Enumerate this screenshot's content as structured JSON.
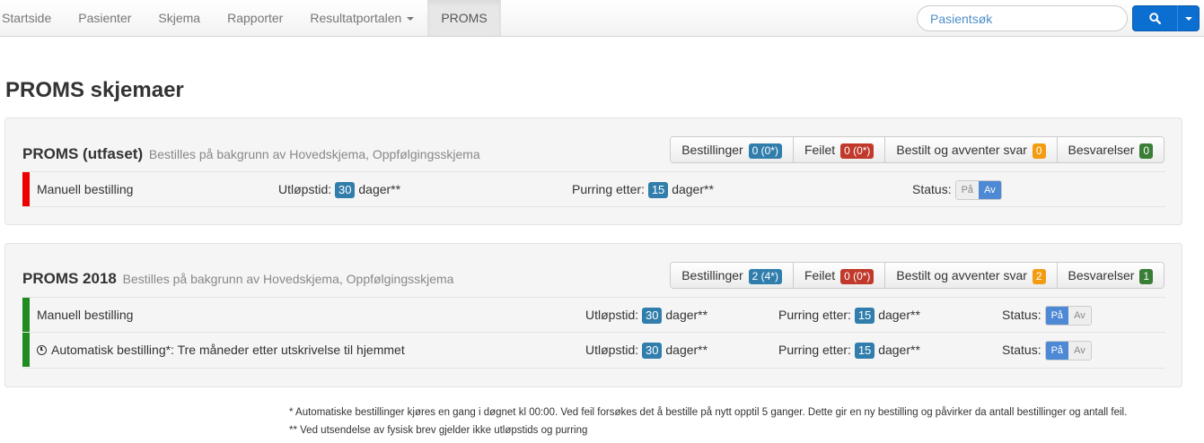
{
  "navbar": {
    "items": [
      {
        "label": "Startside"
      },
      {
        "label": "Pasienter"
      },
      {
        "label": "Skjema"
      },
      {
        "label": "Rapporter"
      },
      {
        "label": "Resultatportalen",
        "dropdown": true
      },
      {
        "label": "PROMS",
        "active": true
      }
    ],
    "search_placeholder": "Pasientsøk",
    "search_icon": "search-icon",
    "accent_color": "#0b6fd1"
  },
  "page_title": "PROMS skjemaer",
  "sections": [
    {
      "title": "PROMS (utfaset)",
      "subtitle": "Bestilles på bakgrunn av Hovedskjema, Oppfølgingsskjema",
      "stats": {
        "bestillinger_label": "Bestillinger",
        "bestillinger_value": "0 (0*)",
        "bestillinger_color": "#317eac",
        "feilet_label": "Feilet",
        "feilet_value": "0 (0*)",
        "feilet_color": "#c0392b",
        "avventer_label": "Bestilt og avventer svar",
        "avventer_value": "0",
        "avventer_color": "#f39c12",
        "besvarelser_label": "Besvarelser",
        "besvarelser_value": "0",
        "besvarelser_color": "#3a7d34"
      },
      "rows": [
        {
          "status_color": "#ee0000",
          "name": "Manuell bestilling",
          "utlopstid_label": "Utløpstid:",
          "utlopstid_value": "30",
          "utlopstid_unit": "dager**",
          "purring_label": "Purring etter:",
          "purring_value": "15",
          "purring_unit": "dager**",
          "status_label": "Status:",
          "on_label": "På",
          "off_label": "Av",
          "state": "Av"
        }
      ]
    },
    {
      "title": "PROMS 2018",
      "subtitle": "Bestilles på bakgrunn av Hovedskjema, Oppfølgingsskjema",
      "stats": {
        "bestillinger_label": "Bestillinger",
        "bestillinger_value": "2 (4*)",
        "bestillinger_color": "#317eac",
        "feilet_label": "Feilet",
        "feilet_value": "0 (0*)",
        "feilet_color": "#c0392b",
        "avventer_label": "Bestilt og avventer svar",
        "avventer_value": "2",
        "avventer_color": "#f39c12",
        "besvarelser_label": "Besvarelser",
        "besvarelser_value": "1",
        "besvarelser_color": "#3a7d34"
      },
      "rows": [
        {
          "status_color": "#1e8c1e",
          "name": "Manuell bestilling",
          "utlopstid_label": "Utløpstid:",
          "utlopstid_value": "30",
          "utlopstid_unit": "dager**",
          "purring_label": "Purring etter:",
          "purring_value": "15",
          "purring_unit": "dager**",
          "status_label": "Status:",
          "on_label": "På",
          "off_label": "Av",
          "state": "På"
        },
        {
          "status_color": "#1e8c1e",
          "icon": "clock-icon",
          "name": "Automatisk bestilling*: Tre måneder etter utskrivelse til hjemmet",
          "utlopstid_label": "Utløpstid:",
          "utlopstid_value": "30",
          "utlopstid_unit": "dager**",
          "purring_label": "Purring etter:",
          "purring_value": "15",
          "purring_unit": "dager**",
          "status_label": "Status:",
          "on_label": "På",
          "off_label": "Av",
          "state": "På"
        }
      ]
    }
  ],
  "footnotes": [
    "* Automatiske bestillinger kjøres en gang i døgnet kl 00:00. Ved feil forsøkes det å bestille på nytt opptil 5 ganger. Dette gir en ny bestilling og påvirker da antall bestillinger og antall feil.",
    "** Ved utsendelse av fysisk brev gjelder ikke utløpstids og purring"
  ]
}
